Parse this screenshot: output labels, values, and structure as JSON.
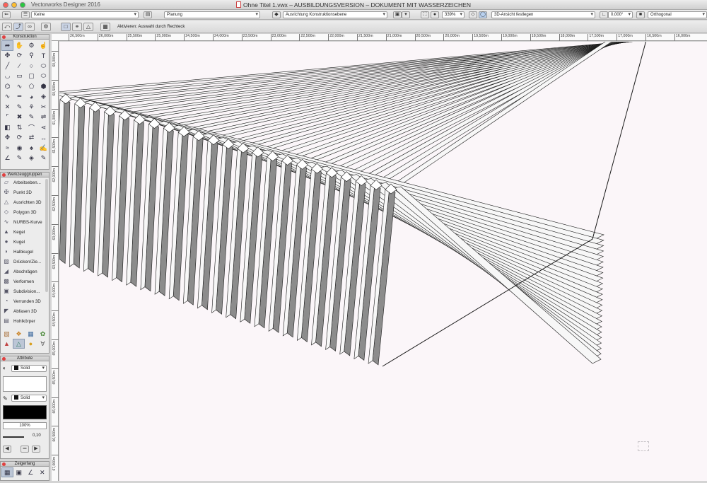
{
  "window": {
    "app_name": "Vectorworks Designer 2016",
    "title": "Ohne Titel 1.vwx – AUSBILDUNGSVERSION – DOKUMENT MIT WASSERZEICHEN"
  },
  "toolbar1": {
    "class_value": "Keine",
    "layer_value": "Planung",
    "plane_value": "Ausrichtung Konstruktionsebene",
    "zoom_value": "339%",
    "view_value": "3D-Ansicht festlegen",
    "angle_value": "0,000°",
    "projection_value": "Orthogonal"
  },
  "toolbar2": {
    "mode_hint": "Aktivieren: Auswahl durch Rechteck"
  },
  "panels": {
    "konstruktion": {
      "title": "Konstruktion"
    },
    "werkzeuggruppen": {
      "title": "Werkzeuggruppen",
      "items": [
        {
          "label": "Arbeitseben...",
          "icon": "work-plane-icon"
        },
        {
          "label": "Punkt 3D",
          "icon": "point-3d-icon"
        },
        {
          "label": "Ausrichten 3D",
          "icon": "align-3d-icon"
        },
        {
          "label": "Polygon 3D",
          "icon": "polygon-3d-icon"
        },
        {
          "label": "NURBS-Kurve",
          "icon": "nurbs-curve-icon"
        },
        {
          "label": "Kegel",
          "icon": "cone-icon"
        },
        {
          "label": "Kugel",
          "icon": "sphere-icon"
        },
        {
          "label": "Halbkugel",
          "icon": "hemisphere-icon"
        },
        {
          "label": "Drücken/Zie...",
          "icon": "push-pull-icon"
        },
        {
          "label": "Abschrägen",
          "icon": "taper-icon"
        },
        {
          "label": "Verformen",
          "icon": "deform-icon"
        },
        {
          "label": "Subdivision...",
          "icon": "subdivision-icon"
        },
        {
          "label": "Verrunden 3D",
          "icon": "fillet-3d-icon"
        },
        {
          "label": "Abfasen 3D",
          "icon": "chamfer-3d-icon"
        },
        {
          "label": "Hohlkörper",
          "icon": "shell-solid-icon"
        }
      ]
    },
    "attribute": {
      "title": "Attribute",
      "fill_style": "Solid",
      "pen_style": "Solid",
      "opacity": "100%",
      "line_weight": "0,10"
    },
    "zeigerfang": {
      "title": "Zeigerfang"
    }
  },
  "ruler_top": [
    "26,500m",
    "26,000m",
    "25,500m",
    "25,000m",
    "24,500m",
    "24,000m",
    "23,500m",
    "23,000m",
    "22,500m",
    "22,000m",
    "21,500m",
    "21,000m",
    "20,500m",
    "20,000m",
    "19,500m",
    "19,000m",
    "18,500m",
    "18,000m",
    "17,500m",
    "17,000m",
    "16,500m",
    "16,000m"
  ],
  "ruler_left": [
    "60,000m",
    "60,500m",
    "61,000m",
    "61,500m",
    "62,000m",
    "62,500m",
    "63,000m",
    "63,500m",
    "64,000m",
    "64,500m",
    "65,000m",
    "65,500m",
    "66,000m",
    "66,500m",
    "67,000m"
  ],
  "colors": {
    "canvas": "#fbf6f9",
    "slat_top": "#f7f7f7",
    "slat_side": "#8c8c8c",
    "slat_edge": "#1a1a1a"
  }
}
